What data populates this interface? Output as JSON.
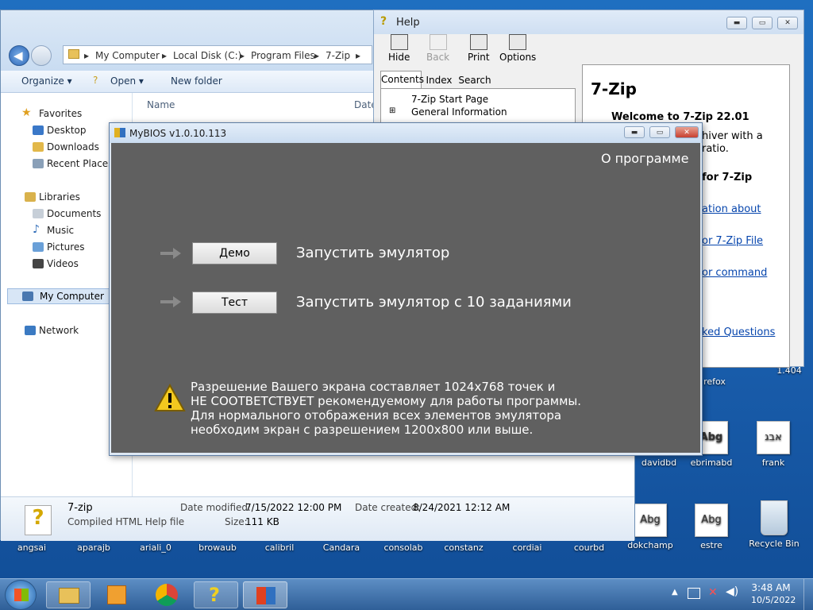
{
  "explorer": {
    "breadcrumb": [
      "My Computer",
      "Local Disk (C:)",
      "Program Files",
      "7-Zip"
    ],
    "toolbar": {
      "organize": "Organize",
      "open": "Open",
      "new_folder": "New folder"
    },
    "column_name": "Name",
    "column_date": "Date",
    "nav": {
      "favorites": "Favorites",
      "fav_items": [
        "Desktop",
        "Downloads",
        "Recent Places"
      ],
      "libraries": "Libraries",
      "lib_items": [
        "Documents",
        "Music",
        "Pictures",
        "Videos"
      ],
      "my_computer": "My Computer",
      "network": "Network"
    },
    "details": {
      "filename": "7-zip",
      "filetype": "Compiled HTML Help file",
      "date_modified_label": "Date modified:",
      "date_modified": "7/15/2022 12:00 PM",
      "size_label": "Size:",
      "size": "111 KB",
      "date_created_label": "Date created:",
      "date_created": "8/24/2021 12:12 AM"
    }
  },
  "help": {
    "title": "Help",
    "buttons": {
      "hide": "Hide",
      "back": "Back",
      "print": "Print",
      "options": "Options"
    },
    "tabs": [
      "Contents",
      "Index",
      "Search"
    ],
    "tree": [
      "7-Zip Start Page",
      "General Information"
    ],
    "content": {
      "heading": "7-Zip",
      "welcome": "Welcome to 7-Zip 22.01",
      "line1": "hiver with a",
      "line2": "ratio.",
      "for7zip": "for 7-Zip",
      "link1": "ation about",
      "link2": "or 7-Zip File",
      "link3": "or command",
      "link4": "ked Questions"
    }
  },
  "mybios": {
    "title": "MyBIOS v1.0.10.113",
    "about": "О программе",
    "demo_button": "Демо",
    "demo_text": "Запустить эмулятор",
    "test_button": "Тест",
    "test_text": "Запустить эмулятор с 10 заданиями",
    "warning": [
      "Разрешение Вашего экрана составляет 1024x768 точек и",
      "НЕ СООТВЕТСТВУЕТ рекомендуемому для работы программы.",
      "Для нормального отображения всех элементов эмулятора",
      "необходим экран с разрешением 1200x800 или выше."
    ]
  },
  "desktop": {
    "right_icons": {
      "refox": "refox",
      "v1404": "1.404",
      "davidbd": "davidbd",
      "ebrimabd": "ebrimabd",
      "frank": "frank",
      "dokchamp": "dokchamp",
      "estre": "estre",
      "recycle": "Recycle Bin"
    },
    "abg": "Abg",
    "hebrew": "אבג",
    "font_row": [
      "angsai",
      "aparajb",
      "ariali_0",
      "browaub",
      "calibril",
      "Candara",
      "consolab",
      "constanz",
      "cordiai",
      "courbd"
    ]
  },
  "taskbar": {
    "time": "3:48 AM",
    "date": "10/5/2022"
  }
}
